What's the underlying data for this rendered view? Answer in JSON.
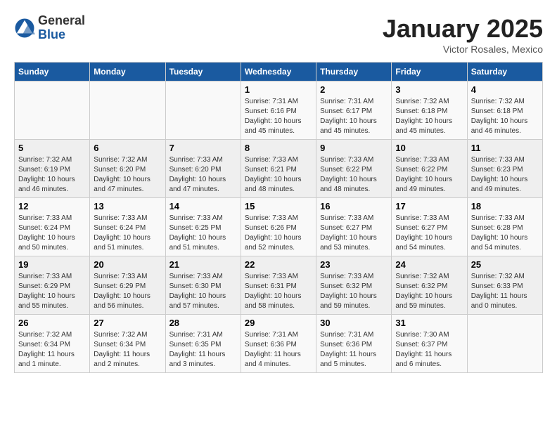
{
  "header": {
    "logo_general": "General",
    "logo_blue": "Blue",
    "month": "January 2025",
    "location": "Victor Rosales, Mexico"
  },
  "days_of_week": [
    "Sunday",
    "Monday",
    "Tuesday",
    "Wednesday",
    "Thursday",
    "Friday",
    "Saturday"
  ],
  "weeks": [
    [
      {
        "num": "",
        "info": ""
      },
      {
        "num": "",
        "info": ""
      },
      {
        "num": "",
        "info": ""
      },
      {
        "num": "1",
        "info": "Sunrise: 7:31 AM\nSunset: 6:16 PM\nDaylight: 10 hours\nand 45 minutes."
      },
      {
        "num": "2",
        "info": "Sunrise: 7:31 AM\nSunset: 6:17 PM\nDaylight: 10 hours\nand 45 minutes."
      },
      {
        "num": "3",
        "info": "Sunrise: 7:32 AM\nSunset: 6:18 PM\nDaylight: 10 hours\nand 45 minutes."
      },
      {
        "num": "4",
        "info": "Sunrise: 7:32 AM\nSunset: 6:18 PM\nDaylight: 10 hours\nand 46 minutes."
      }
    ],
    [
      {
        "num": "5",
        "info": "Sunrise: 7:32 AM\nSunset: 6:19 PM\nDaylight: 10 hours\nand 46 minutes."
      },
      {
        "num": "6",
        "info": "Sunrise: 7:32 AM\nSunset: 6:20 PM\nDaylight: 10 hours\nand 47 minutes."
      },
      {
        "num": "7",
        "info": "Sunrise: 7:33 AM\nSunset: 6:20 PM\nDaylight: 10 hours\nand 47 minutes."
      },
      {
        "num": "8",
        "info": "Sunrise: 7:33 AM\nSunset: 6:21 PM\nDaylight: 10 hours\nand 48 minutes."
      },
      {
        "num": "9",
        "info": "Sunrise: 7:33 AM\nSunset: 6:22 PM\nDaylight: 10 hours\nand 48 minutes."
      },
      {
        "num": "10",
        "info": "Sunrise: 7:33 AM\nSunset: 6:22 PM\nDaylight: 10 hours\nand 49 minutes."
      },
      {
        "num": "11",
        "info": "Sunrise: 7:33 AM\nSunset: 6:23 PM\nDaylight: 10 hours\nand 49 minutes."
      }
    ],
    [
      {
        "num": "12",
        "info": "Sunrise: 7:33 AM\nSunset: 6:24 PM\nDaylight: 10 hours\nand 50 minutes."
      },
      {
        "num": "13",
        "info": "Sunrise: 7:33 AM\nSunset: 6:24 PM\nDaylight: 10 hours\nand 51 minutes."
      },
      {
        "num": "14",
        "info": "Sunrise: 7:33 AM\nSunset: 6:25 PM\nDaylight: 10 hours\nand 51 minutes."
      },
      {
        "num": "15",
        "info": "Sunrise: 7:33 AM\nSunset: 6:26 PM\nDaylight: 10 hours\nand 52 minutes."
      },
      {
        "num": "16",
        "info": "Sunrise: 7:33 AM\nSunset: 6:27 PM\nDaylight: 10 hours\nand 53 minutes."
      },
      {
        "num": "17",
        "info": "Sunrise: 7:33 AM\nSunset: 6:27 PM\nDaylight: 10 hours\nand 54 minutes."
      },
      {
        "num": "18",
        "info": "Sunrise: 7:33 AM\nSunset: 6:28 PM\nDaylight: 10 hours\nand 54 minutes."
      }
    ],
    [
      {
        "num": "19",
        "info": "Sunrise: 7:33 AM\nSunset: 6:29 PM\nDaylight: 10 hours\nand 55 minutes."
      },
      {
        "num": "20",
        "info": "Sunrise: 7:33 AM\nSunset: 6:29 PM\nDaylight: 10 hours\nand 56 minutes."
      },
      {
        "num": "21",
        "info": "Sunrise: 7:33 AM\nSunset: 6:30 PM\nDaylight: 10 hours\nand 57 minutes."
      },
      {
        "num": "22",
        "info": "Sunrise: 7:33 AM\nSunset: 6:31 PM\nDaylight: 10 hours\nand 58 minutes."
      },
      {
        "num": "23",
        "info": "Sunrise: 7:33 AM\nSunset: 6:32 PM\nDaylight: 10 hours\nand 59 minutes."
      },
      {
        "num": "24",
        "info": "Sunrise: 7:32 AM\nSunset: 6:32 PM\nDaylight: 10 hours\nand 59 minutes."
      },
      {
        "num": "25",
        "info": "Sunrise: 7:32 AM\nSunset: 6:33 PM\nDaylight: 11 hours\nand 0 minutes."
      }
    ],
    [
      {
        "num": "26",
        "info": "Sunrise: 7:32 AM\nSunset: 6:34 PM\nDaylight: 11 hours\nand 1 minute."
      },
      {
        "num": "27",
        "info": "Sunrise: 7:32 AM\nSunset: 6:34 PM\nDaylight: 11 hours\nand 2 minutes."
      },
      {
        "num": "28",
        "info": "Sunrise: 7:31 AM\nSunset: 6:35 PM\nDaylight: 11 hours\nand 3 minutes."
      },
      {
        "num": "29",
        "info": "Sunrise: 7:31 AM\nSunset: 6:36 PM\nDaylight: 11 hours\nand 4 minutes."
      },
      {
        "num": "30",
        "info": "Sunrise: 7:31 AM\nSunset: 6:36 PM\nDaylight: 11 hours\nand 5 minutes."
      },
      {
        "num": "31",
        "info": "Sunrise: 7:30 AM\nSunset: 6:37 PM\nDaylight: 11 hours\nand 6 minutes."
      },
      {
        "num": "",
        "info": ""
      }
    ]
  ]
}
